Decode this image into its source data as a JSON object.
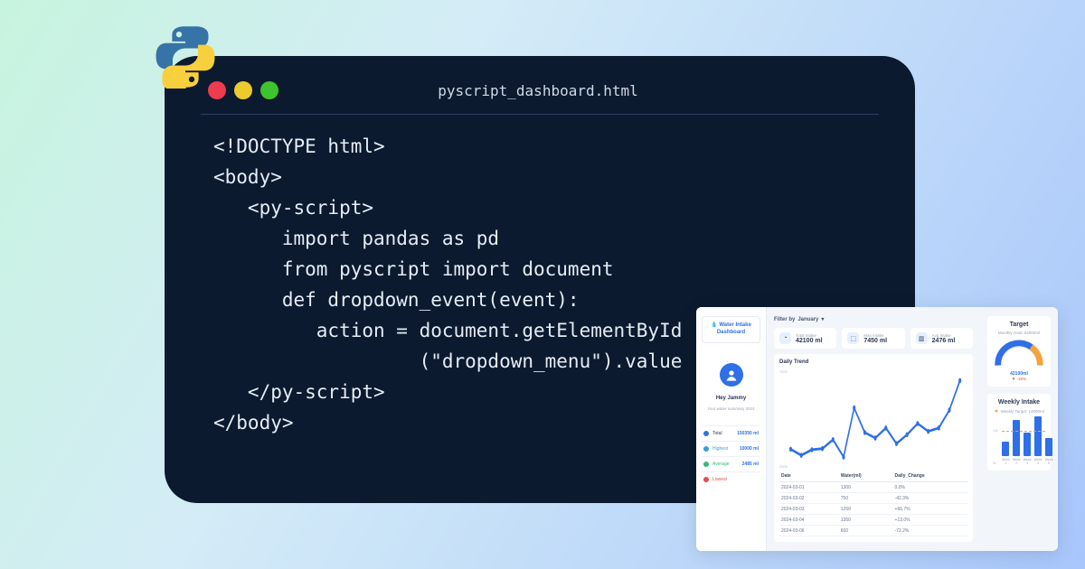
{
  "code_window": {
    "filename": "pyscript_dashboard.html",
    "lines": [
      "<!DOCTYPE html>",
      "<body>",
      "   <py-script>",
      "      import pandas as pd",
      "      from pyscript import document",
      "      def dropdown_event(event):",
      "         action = document.getElementById",
      "                  (\"dropdown_menu\").value",
      "   </py-script>",
      "</body>"
    ]
  },
  "dashboard": {
    "title": "Water Intake Dashboard",
    "greeting": "Hey Jammy",
    "greeting_sub": "Your water summary 2024",
    "side_stats": [
      {
        "label": "Total",
        "value": "150350 ml",
        "tone": "c-blue",
        "val_tone": "blue"
      },
      {
        "label": "Highest",
        "value": "10000 ml",
        "tone": "c-teal",
        "val_tone": "blue"
      },
      {
        "label": "Average",
        "value": "2485 ml",
        "tone": "c-green",
        "val_tone": "blue"
      },
      {
        "label": "Lowest",
        "value": "",
        "tone": "c-red",
        "val_tone": ""
      }
    ],
    "filter_label": "Filter by",
    "filter_value": "January",
    "kpis": [
      {
        "label": "Total Intake",
        "value": "42100 ml",
        "glyph": "◔"
      },
      {
        "label": "Max Intake",
        "value": "7450 ml",
        "glyph": "⬚"
      },
      {
        "label": "Avg Intake",
        "value": "2476 ml",
        "glyph": "▥"
      }
    ],
    "trend_title": "Daily Trend",
    "trend_yticks": [
      "7000",
      "2000"
    ],
    "table": {
      "headers": [
        "Date",
        "Water(ml)",
        "Daily_Change"
      ],
      "rows": [
        {
          "date": "2024-03-01",
          "water": "1300",
          "change": "0.0%",
          "dir": "pos"
        },
        {
          "date": "2024-03-02",
          "water": "750",
          "change": "-42.3%",
          "dir": "neg"
        },
        {
          "date": "2024-03-03",
          "water": "1250",
          "change": "+66.7%",
          "dir": "pos"
        },
        {
          "date": "2024-03-04",
          "water": "1350",
          "change": "+13.0%",
          "dir": "pos"
        },
        {
          "date": "2024-03-06",
          "water": "600",
          "change": "-72.2%",
          "dir": "neg"
        }
      ]
    },
    "target": {
      "title": "Target",
      "sub": "Monthly Goal: 62000ml",
      "value": "42100ml",
      "delta": "▼ -32%"
    },
    "weekly": {
      "title": "Weekly Intake",
      "sub": "Weekly Target: 14000ml",
      "yticks": [
        "12k",
        "5k"
      ],
      "bars": [
        {
          "label": "Week 1",
          "h": 16
        },
        {
          "label": "Week 2",
          "h": 40
        },
        {
          "label": "Week 3",
          "h": 26
        },
        {
          "label": "Week 4",
          "h": 44
        },
        {
          "label": "Week 5",
          "h": 20
        }
      ]
    }
  },
  "chart_data": [
    {
      "type": "line",
      "title": "Daily Trend",
      "ylabel": "",
      "ylim": [
        0,
        8000
      ],
      "x": [
        1,
        2,
        3,
        4,
        5,
        6,
        7,
        8,
        9,
        10,
        11,
        12,
        13,
        14,
        15,
        16,
        17
      ],
      "values": [
        1300,
        750,
        1250,
        1350,
        2150,
        600,
        5000,
        2800,
        2300,
        3200,
        1800,
        2600,
        3600,
        2900,
        3200,
        4800,
        7450
      ]
    },
    {
      "type": "gauge",
      "title": "Target",
      "subtitle": "Monthly Goal: 62000ml",
      "value": 42100,
      "max": 62000,
      "percent_of_goal": 68,
      "delta_label": "-32%"
    },
    {
      "type": "bar",
      "title": "Weekly Intake",
      "subtitle": "Weekly Target: 14000ml",
      "target_line": 14000,
      "ylim": [
        0,
        15000
      ],
      "categories": [
        "Week 1",
        "Week 2",
        "Week 3",
        "Week 4",
        "Week 5"
      ],
      "values": [
        5000,
        12500,
        8000,
        13800,
        6200
      ]
    }
  ]
}
